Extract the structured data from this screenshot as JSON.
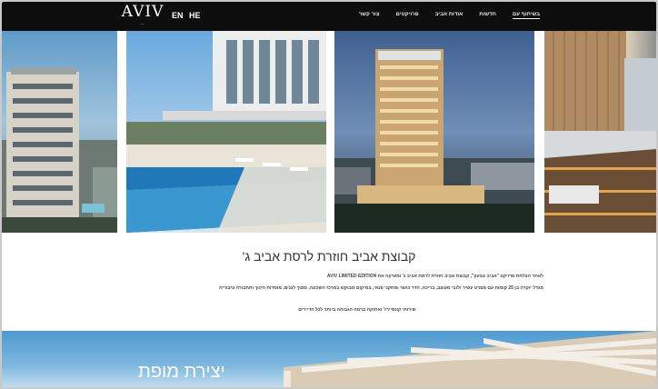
{
  "header": {
    "logo": {
      "wordmark": "AVIV",
      "tagline": "—"
    },
    "languages": [
      "EN",
      "HE"
    ],
    "nav": [
      {
        "label": "צור קשר",
        "active": false
      },
      {
        "label": "פרויקטים",
        "active": false
      },
      {
        "label": "אודות אביב",
        "active": false
      },
      {
        "label": "חדשות",
        "active": false
      },
      {
        "label": "בשיתוף עם",
        "active": true
      }
    ]
  },
  "gallery": {
    "images": [
      "tower-rendering",
      "pool-deck-rendering",
      "tower-night-rendering",
      "sauna-interior-rendering"
    ]
  },
  "info": {
    "title": "קבוצת אביב חוזרת לרסת אביב ג'",
    "paragraph_1": "לאחר הצלחת פרויקט \"אביב טבעון\", קבוצת אביב חוזרת לרמת אביב ג' ומשיקה את AVIV LIMITED EDITION",
    "paragraph_2": "מגדל יוקרה בן 25 קומות עם מפרט עשיר ולובי מעוצב, בריכה, חדר כושר ומתקני פנאי, במיקום מבוקש במרכז השכונה, סמוך לגנים, מוסדות חינוך ותחבורה ציבורית",
    "paragraph_3": "שירותי קונסיירז' ואחזקה ברמה הגבוהה ביותר לכל הדיירים"
  },
  "hero": {
    "headline": "יצירת מופת"
  }
}
